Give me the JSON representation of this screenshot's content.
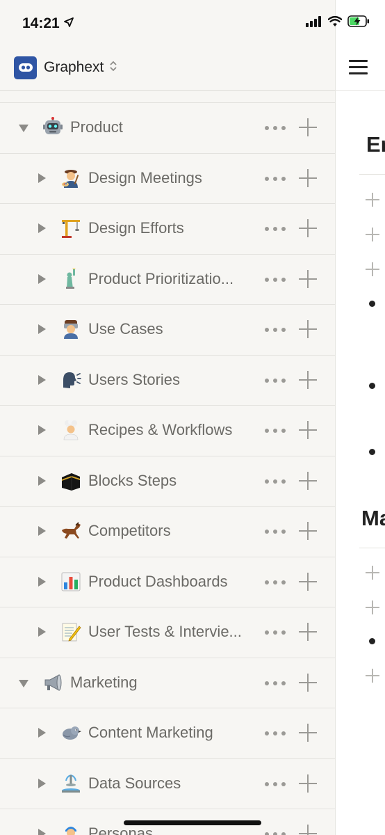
{
  "status_bar": {
    "time": "14:21"
  },
  "workspace": {
    "name": "Graphext"
  },
  "sidebar": {
    "items": [
      {
        "label": "Product",
        "emoji": "robot-face-icon",
        "level": "top",
        "expanded": true
      },
      {
        "label": "Design Meetings",
        "emoji": "artist-icon",
        "level": "sub",
        "expanded": false
      },
      {
        "label": "Design Efforts",
        "emoji": "construction-crane-icon",
        "level": "sub",
        "expanded": false
      },
      {
        "label": "Product Prioritizatio...",
        "emoji": "statue-of-liberty-icon",
        "level": "sub",
        "expanded": false
      },
      {
        "label": "Use Cases",
        "emoji": "factory-worker-icon",
        "level": "sub",
        "expanded": false
      },
      {
        "label": "Users Stories",
        "emoji": "speaking-head-icon",
        "level": "sub",
        "expanded": false
      },
      {
        "label": "Recipes & Workflows",
        "emoji": "cook-icon",
        "level": "sub",
        "expanded": false
      },
      {
        "label": "Blocks Steps",
        "emoji": "kaaba-icon",
        "level": "sub",
        "expanded": false
      },
      {
        "label": "Competitors",
        "emoji": "racehorse-icon",
        "level": "sub",
        "expanded": false
      },
      {
        "label": "Product Dashboards",
        "emoji": "bar-chart-icon",
        "level": "sub",
        "expanded": false
      },
      {
        "label": "User Tests & Intervie...",
        "emoji": "memo-icon",
        "level": "sub",
        "expanded": false
      },
      {
        "label": "Marketing",
        "emoji": "loudspeaker-icon",
        "level": "top",
        "expanded": true
      },
      {
        "label": "Content Marketing",
        "emoji": "bird-icon",
        "level": "sub",
        "expanded": false
      },
      {
        "label": "Data Sources",
        "emoji": "fountain-icon",
        "level": "sub",
        "expanded": false
      },
      {
        "label": "Personas",
        "emoji": "person-icon",
        "level": "sub",
        "expanded": false
      }
    ]
  },
  "main": {
    "headings": [
      "En",
      "Ma"
    ]
  },
  "colors": {
    "sidebar_bg": "#f7f6f3",
    "workspace_logo": "#2f55a4",
    "muted_text": "#6b6a66",
    "icon_gray": "#9b9a96"
  }
}
